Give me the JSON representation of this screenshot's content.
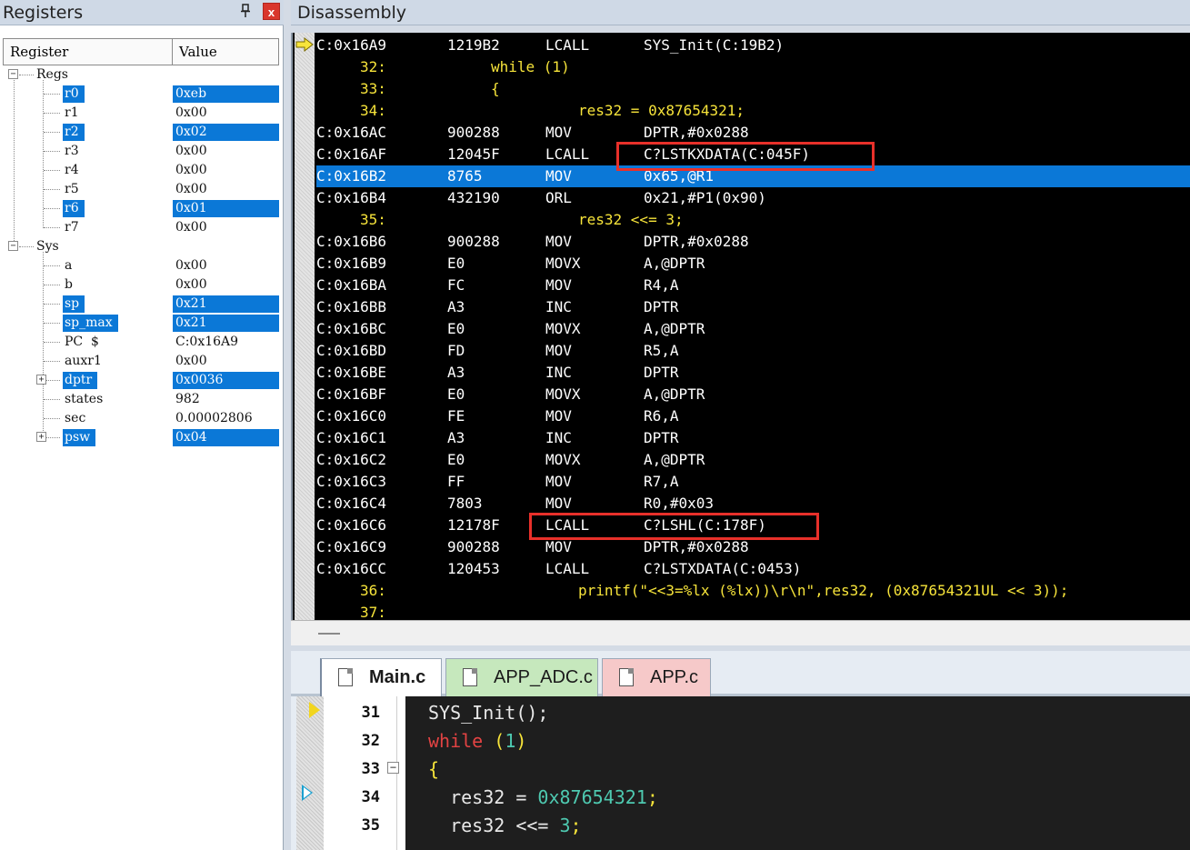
{
  "registers": {
    "title": "Registers",
    "pin_glyph": "ᵖ",
    "close_glyph": "x",
    "col_register": "Register",
    "col_value": "Value",
    "groups": [
      {
        "name": "Regs",
        "expander": "−"
      },
      {
        "name": "Sys",
        "expander": "−"
      }
    ],
    "rows": [
      {
        "name": "r0",
        "value": "0xeb",
        "selected": true
      },
      {
        "name": "r1",
        "value": "0x00",
        "selected": false
      },
      {
        "name": "r2",
        "value": "0x02",
        "selected": true
      },
      {
        "name": "r3",
        "value": "0x00",
        "selected": false
      },
      {
        "name": "r4",
        "value": "0x00",
        "selected": false
      },
      {
        "name": "r5",
        "value": "0x00",
        "selected": false
      },
      {
        "name": "r6",
        "value": "0x01",
        "selected": true
      },
      {
        "name": "r7",
        "value": "0x00",
        "selected": false
      },
      {
        "name": "a",
        "value": "0x00",
        "selected": false
      },
      {
        "name": "b",
        "value": "0x00",
        "selected": false
      },
      {
        "name": "sp",
        "value": "0x21",
        "selected": true
      },
      {
        "name": "sp_max",
        "value": "0x21",
        "selected": true
      },
      {
        "name": "PC  $",
        "value": "C:0x16A9",
        "selected": false
      },
      {
        "name": "auxr1",
        "value": "0x00",
        "selected": false
      },
      {
        "name": "dptr",
        "value": "0x0036",
        "selected": true,
        "expander": "+"
      },
      {
        "name": "states",
        "value": "982",
        "selected": false
      },
      {
        "name": "sec",
        "value": "0.00002806",
        "selected": false
      },
      {
        "name": "psw",
        "value": "0x04",
        "selected": true,
        "expander": "+"
      }
    ]
  },
  "disassembly": {
    "title": "Disassembly",
    "lines": [
      {
        "kind": "asm",
        "addr": "C:0x16A9",
        "op": "1219B2",
        "mn": "LCALL",
        "arg": "SYS_Init(C:19B2)"
      },
      {
        "kind": "src",
        "ln": "32:",
        "src": "while (1)",
        "indent": 192
      },
      {
        "kind": "src",
        "ln": "33:",
        "src": "{",
        "indent": 192
      },
      {
        "kind": "src",
        "ln": "34:",
        "src": "res32 = 0x87654321;",
        "indent": 288
      },
      {
        "kind": "asm",
        "addr": "C:0x16AC",
        "op": "900288",
        "mn": "MOV",
        "arg": "DPTR,#0x0288"
      },
      {
        "kind": "asm",
        "addr": "C:0x16AF",
        "op": "12045F",
        "mn": "LCALL",
        "arg": "C?LSTKXDATA(C:045F)"
      },
      {
        "kind": "asm",
        "addr": "C:0x16B2",
        "op": "8765",
        "mn": "MOV",
        "arg": "0x65,@R1",
        "highlight": true
      },
      {
        "kind": "asm",
        "addr": "C:0x16B4",
        "op": "432190",
        "mn": "ORL",
        "arg": "0x21,#P1(0x90)"
      },
      {
        "kind": "src",
        "ln": "35:",
        "src": "res32 <<= 3;",
        "indent": 288
      },
      {
        "kind": "asm",
        "addr": "C:0x16B6",
        "op": "900288",
        "mn": "MOV",
        "arg": "DPTR,#0x0288"
      },
      {
        "kind": "asm",
        "addr": "C:0x16B9",
        "op": "E0",
        "mn": "MOVX",
        "arg": "A,@DPTR"
      },
      {
        "kind": "asm",
        "addr": "C:0x16BA",
        "op": "FC",
        "mn": "MOV",
        "arg": "R4,A"
      },
      {
        "kind": "asm",
        "addr": "C:0x16BB",
        "op": "A3",
        "mn": "INC",
        "arg": "DPTR"
      },
      {
        "kind": "asm",
        "addr": "C:0x16BC",
        "op": "E0",
        "mn": "MOVX",
        "arg": "A,@DPTR"
      },
      {
        "kind": "asm",
        "addr": "C:0x16BD",
        "op": "FD",
        "mn": "MOV",
        "arg": "R5,A"
      },
      {
        "kind": "asm",
        "addr": "C:0x16BE",
        "op": "A3",
        "mn": "INC",
        "arg": "DPTR"
      },
      {
        "kind": "asm",
        "addr": "C:0x16BF",
        "op": "E0",
        "mn": "MOVX",
        "arg": "A,@DPTR"
      },
      {
        "kind": "asm",
        "addr": "C:0x16C0",
        "op": "FE",
        "mn": "MOV",
        "arg": "R6,A"
      },
      {
        "kind": "asm",
        "addr": "C:0x16C1",
        "op": "A3",
        "mn": "INC",
        "arg": "DPTR"
      },
      {
        "kind": "asm",
        "addr": "C:0x16C2",
        "op": "E0",
        "mn": "MOVX",
        "arg": "A,@DPTR"
      },
      {
        "kind": "asm",
        "addr": "C:0x16C3",
        "op": "FF",
        "mn": "MOV",
        "arg": "R7,A"
      },
      {
        "kind": "asm",
        "addr": "C:0x16C4",
        "op": "7803",
        "mn": "MOV",
        "arg": "R0,#0x03"
      },
      {
        "kind": "asm",
        "addr": "C:0x16C6",
        "op": "12178F",
        "mn": "LCALL",
        "arg": "C?LSHL(C:178F)"
      },
      {
        "kind": "asm",
        "addr": "C:0x16C9",
        "op": "900288",
        "mn": "MOV",
        "arg": "DPTR,#0x0288"
      },
      {
        "kind": "asm",
        "addr": "C:0x16CC",
        "op": "120453",
        "mn": "LCALL",
        "arg": "C?LSTXDATA(C:0453)"
      },
      {
        "kind": "src",
        "ln": "36:",
        "src": "printf(\"<<3=%lx (%lx))\\r\\n\",res32, (0x87654321UL << 3));",
        "indent": 288
      },
      {
        "kind": "src",
        "ln": "37:",
        "src": "",
        "indent": 288
      }
    ],
    "scroll_glyph": "—"
  },
  "editor": {
    "tabs": [
      {
        "label": "Main.c",
        "active": true
      },
      {
        "label": "APP_ADC.c",
        "active": false
      },
      {
        "label": "APP.c",
        "active": false
      }
    ],
    "fold_glyph": "−",
    "lines": [
      {
        "num": "31",
        "parts": [
          {
            "t": "SYS_Init();",
            "c": ""
          }
        ]
      },
      {
        "num": "32",
        "parts": [
          {
            "t": "while",
            "c": "kw"
          },
          {
            "t": " ",
            "c": ""
          },
          {
            "t": "(",
            "c": "pn"
          },
          {
            "t": "1",
            "c": "nm"
          },
          {
            "t": ")",
            "c": "pn"
          }
        ]
      },
      {
        "num": "33",
        "parts": [
          {
            "t": "{",
            "c": "pn"
          }
        ]
      },
      {
        "num": "34",
        "parts": [
          {
            "t": "  res32 = ",
            "c": ""
          },
          {
            "t": "0x87654321",
            "c": "nm"
          },
          {
            "t": ";",
            "c": "pn"
          }
        ]
      },
      {
        "num": "35",
        "parts": [
          {
            "t": "  res32 <<= ",
            "c": ""
          },
          {
            "t": "3",
            "c": "nm"
          },
          {
            "t": ";",
            "c": "pn"
          }
        ]
      }
    ]
  },
  "colors": {
    "selection": "#0b78d7",
    "annotation_box": "#e8302a",
    "source_text": "#f7e43a",
    "keyword": "#e34343",
    "number": "#4ec9b0"
  }
}
